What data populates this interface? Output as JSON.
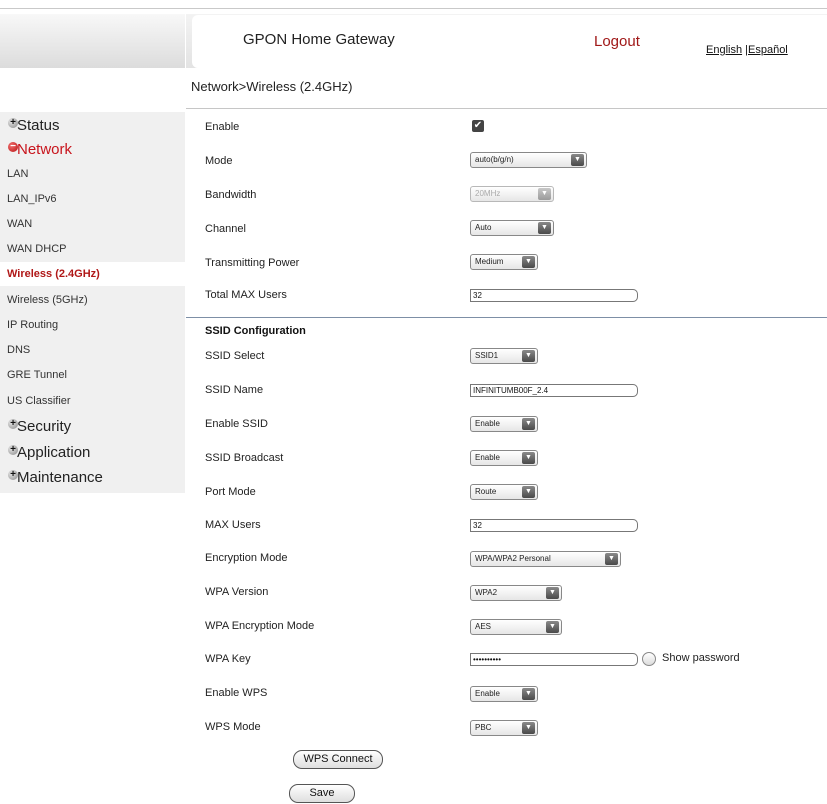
{
  "header": {
    "title": "GPON Home Gateway",
    "logout": "Logout",
    "lang_english": "English",
    "lang_separator": "|",
    "lang_espanol": "Español"
  },
  "breadcrumb": "Network>Wireless (2.4GHz)",
  "sidebar": {
    "status": "Status",
    "network": "Network",
    "items": [
      "LAN",
      "LAN_IPv6",
      "WAN",
      "WAN DHCP",
      "Wireless (2.4GHz)",
      "Wireless (5GHz)",
      "IP Routing",
      "DNS",
      "GRE Tunnel",
      "US Classifier"
    ],
    "security": "Security",
    "application": "Application",
    "maintenance": "Maintenance",
    "plus_icon": "+",
    "minus_icon": "−"
  },
  "form": {
    "enable_label": "Enable",
    "enable_checked": true,
    "mode_label": "Mode",
    "mode_value": "auto(b/g/n)",
    "bandwidth_label": "Bandwidth",
    "bandwidth_value": "20MHz",
    "channel_label": "Channel",
    "channel_value": "Auto",
    "tx_power_label": "Transmitting Power",
    "tx_power_value": "Medium",
    "total_max_users_label": "Total MAX Users",
    "total_max_users_value": "32",
    "ssid_config_header": "SSID Configuration",
    "ssid_select_label": "SSID Select",
    "ssid_select_value": "SSID1",
    "ssid_name_label": "SSID Name",
    "ssid_name_value": "INFINITUMB00F_2.4",
    "enable_ssid_label": "Enable SSID",
    "enable_ssid_value": "Enable",
    "ssid_broadcast_label": "SSID Broadcast",
    "ssid_broadcast_value": "Enable",
    "port_mode_label": "Port Mode",
    "port_mode_value": "Route",
    "max_users_label": "MAX Users",
    "max_users_value": "32",
    "encryption_mode_label": "Encryption Mode",
    "encryption_mode_value": "WPA/WPA2 Personal",
    "wpa_version_label": "WPA Version",
    "wpa_version_value": "WPA2",
    "wpa_encryption_mode_label": "WPA Encryption Mode",
    "wpa_encryption_mode_value": "AES",
    "wpa_key_label": "WPA Key",
    "wpa_key_value": "••••••••••",
    "show_password_label": "Show password",
    "enable_wps_label": "Enable WPS",
    "enable_wps_value": "Enable",
    "wps_mode_label": "WPS Mode",
    "wps_mode_value": "PBC",
    "wps_connect_button": "WPS Connect",
    "save_button": "Save",
    "dropdown_arrow": "▼",
    "checkmark": "✔"
  }
}
